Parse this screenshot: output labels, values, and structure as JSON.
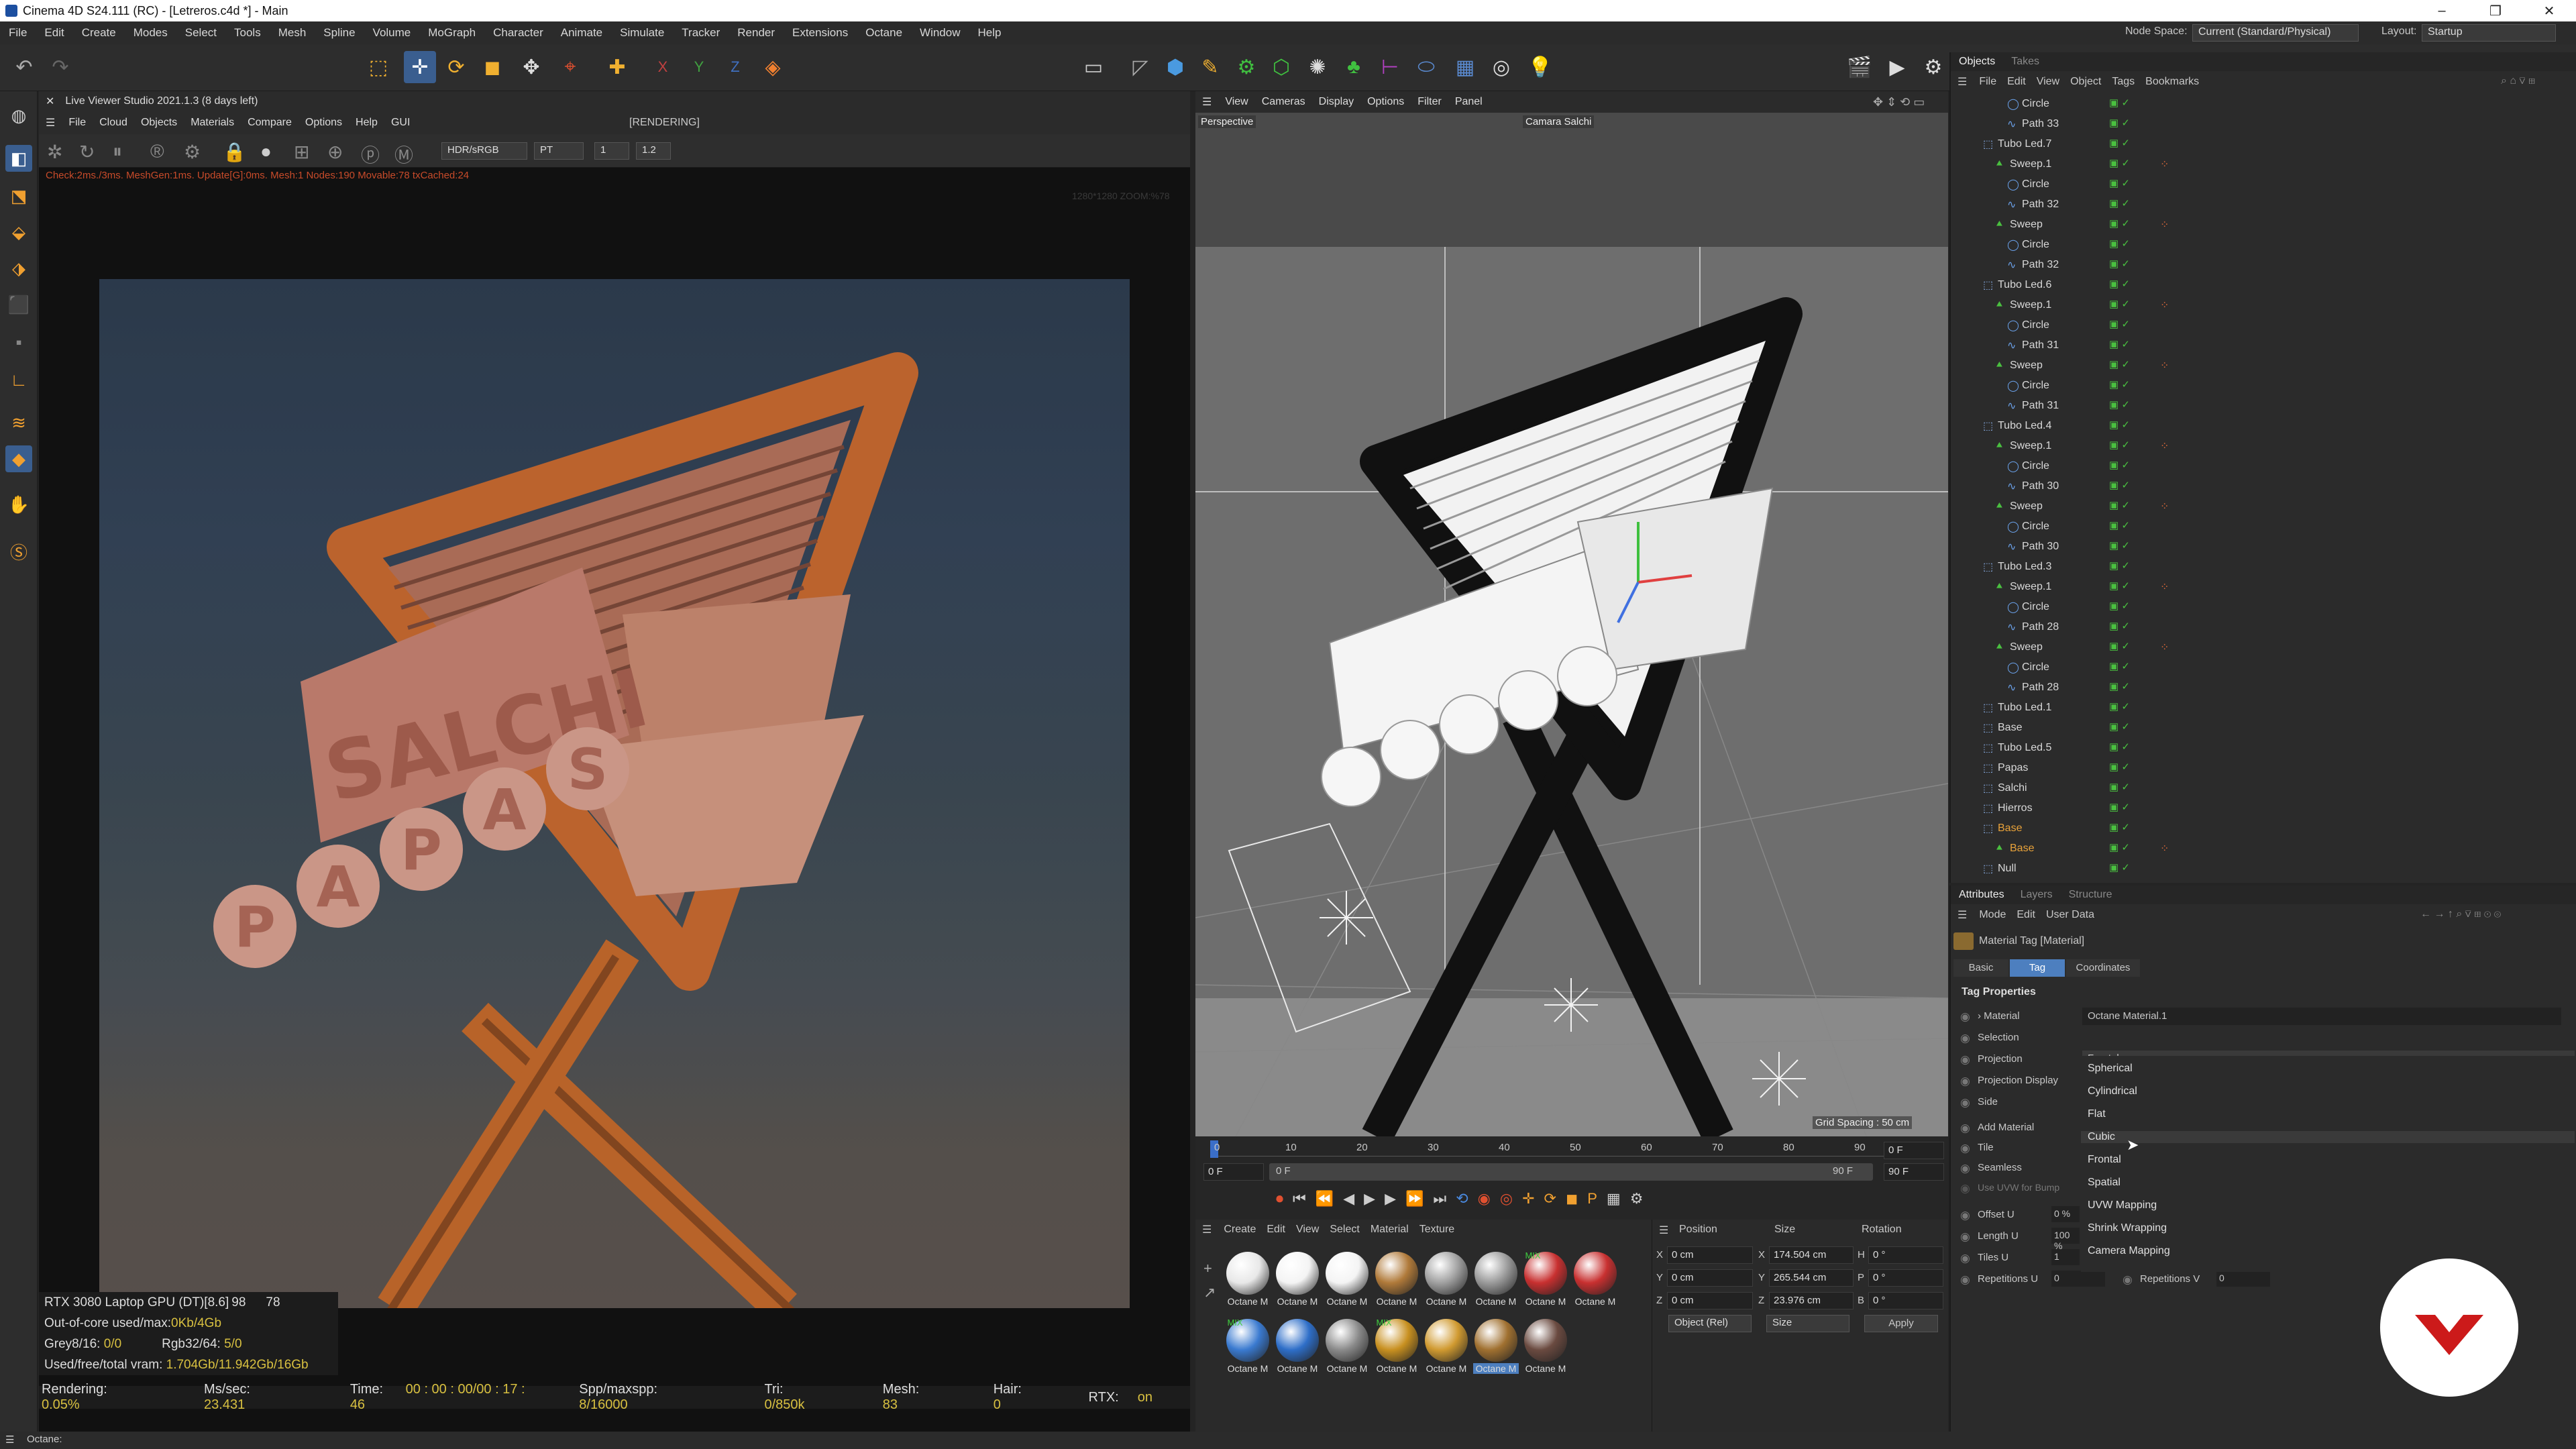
{
  "window": {
    "title": "Cinema 4D S24.111 (RC) - [Letreros.c4d *] - Main"
  },
  "menubar": {
    "items": [
      "File",
      "Edit",
      "Create",
      "Modes",
      "Select",
      "Tools",
      "Mesh",
      "Spline",
      "Volume",
      "MoGraph",
      "Character",
      "Animate",
      "Simulate",
      "Tracker",
      "Render",
      "Extensions",
      "Octane",
      "Window",
      "Help"
    ],
    "node_space_label": "Node Space:",
    "node_space_value": "Current (Standard/Physical)",
    "layout_label": "Layout:",
    "layout_value": "Startup"
  },
  "live_viewer": {
    "title": "Live Viewer Studio 2021.1.3 (8 days left)",
    "menu": [
      "File",
      "Cloud",
      "Objects",
      "Materials",
      "Compare",
      "Options",
      "Help",
      "GUI"
    ],
    "state": "[RENDERING]",
    "color_space": "HDR/sRGB",
    "kernel": "PT",
    "val_a": "1",
    "val_b": "1.2",
    "status_line": "Check:2ms./3ms. MeshGen:1ms. Update[G]:0ms. Mesh:1 Nodes:190 Movable:78 txCached:24",
    "res_text": "1280*1280 ZOOM:%78",
    "gpu": {
      "name": "RTX 3080 Laptop GPU (DT)[8.6]",
      "val1": "98",
      "val2": "78",
      "ooc_label": "Out-of-core used/max:",
      "ooc_value": "0Kb/4Gb",
      "grey_label": "Grey8/16:",
      "grey_value": "0/0",
      "rgb_label": "Rgb32/64:",
      "rgb_value": "5/0",
      "vram_label": "Used/free/total vram:",
      "vram_value": "1.704Gb/11.942Gb/16Gb"
    },
    "stats": {
      "rendering_label": "Rendering:",
      "rendering_value": "0.05%",
      "ms_label": "Ms/sec:",
      "ms_value": "23.431",
      "time_label": "Time:",
      "time_value": "00 : 00 : 00/00 : 17 : 46",
      "spp_label": "Spp/maxspp:",
      "spp_value": "8/16000",
      "tri_label": "Tri:",
      "tri_value": "0/850k",
      "mesh_label": "Mesh:",
      "mesh_value": "83",
      "hair_label": "Hair:",
      "hair_value": "0",
      "rtx_label": "RTX:",
      "rtx_value": "on"
    }
  },
  "viewport": {
    "menu": [
      "View",
      "Cameras",
      "Display",
      "Options",
      "Filter",
      "Panel"
    ],
    "mode_label": "Perspective",
    "camera_label": "Camara Salchi",
    "grid_spacing": "Grid Spacing : 50 cm"
  },
  "timeline": {
    "ticks": [
      "0",
      "10",
      "20",
      "30",
      "40",
      "50",
      "60",
      "70",
      "80",
      "90"
    ],
    "current_frame": "0 F",
    "start": "0 F",
    "start2": "0 F",
    "end": "90 F",
    "end2": "90 F"
  },
  "materials": {
    "menu": [
      "Create",
      "Edit",
      "View",
      "Select",
      "Material",
      "Texture"
    ],
    "items": [
      {
        "label": "Octane M",
        "color": "#e8e8e8"
      },
      {
        "label": "Octane M",
        "color": "#f4f4f4"
      },
      {
        "label": "Octane M",
        "color": "#f4f4f4"
      },
      {
        "label": "Octane M",
        "color": "#b07a3a"
      },
      {
        "label": "Octane M",
        "color": "#a0a0a0"
      },
      {
        "label": "Octane M",
        "color": "#9a9a9a"
      },
      {
        "label": "Octane M",
        "color": "#c83030"
      },
      {
        "label": "Octane M",
        "color": "#c83030"
      },
      {
        "label": "Octane M",
        "color": "#3a7ad0"
      },
      {
        "label": "Octane M",
        "color": "#2e6ec8"
      },
      {
        "label": "Octane M",
        "color": "#8a8a8a"
      },
      {
        "label": "Octane M",
        "color": "#c89020"
      },
      {
        "label": "Octane M",
        "color": "#d09a30"
      },
      {
        "label": "Octane M",
        "color": "#a07030"
      },
      {
        "label": "Octane M",
        "color": "#6a4a40"
      }
    ],
    "mix_badge": "MIX"
  },
  "coordinates": {
    "headers": [
      "Position",
      "Size",
      "Rotation"
    ],
    "rows": [
      {
        "axis": "X",
        "pos": "0 cm",
        "size_axis": "X",
        "size": "174.504 cm",
        "rot_axis": "H",
        "rot": "0 °"
      },
      {
        "axis": "Y",
        "pos": "0 cm",
        "size_axis": "Y",
        "size": "265.544 cm",
        "rot_axis": "P",
        "rot": "0 °"
      },
      {
        "axis": "Z",
        "pos": "0 cm",
        "size_axis": "Z",
        "size": "23.976 cm",
        "rot_axis": "B",
        "rot": "0 °"
      }
    ],
    "mode": "Object (Rel)",
    "size_mode": "Size",
    "apply": "Apply"
  },
  "objects_panel": {
    "tabs": [
      "Objects",
      "Takes"
    ],
    "menu": [
      "File",
      "Edit",
      "View",
      "Object",
      "Tags",
      "Bookmarks"
    ],
    "rows": [
      {
        "label": "Circle",
        "indent": 3,
        "type": "circle"
      },
      {
        "label": "Path 33",
        "indent": 3,
        "type": "path"
      },
      {
        "label": "Tubo Led.7",
        "indent": 1,
        "type": "null"
      },
      {
        "label": "Sweep.1",
        "indent": 2,
        "type": "sweep"
      },
      {
        "label": "Circle",
        "indent": 3,
        "type": "circle"
      },
      {
        "label": "Path 32",
        "indent": 3,
        "type": "path"
      },
      {
        "label": "Sweep",
        "indent": 2,
        "type": "sweep"
      },
      {
        "label": "Circle",
        "indent": 3,
        "type": "circle"
      },
      {
        "label": "Path 32",
        "indent": 3,
        "type": "path"
      },
      {
        "label": "Tubo Led.6",
        "indent": 1,
        "type": "null"
      },
      {
        "label": "Sweep.1",
        "indent": 2,
        "type": "sweep"
      },
      {
        "label": "Circle",
        "indent": 3,
        "type": "circle"
      },
      {
        "label": "Path 31",
        "indent": 3,
        "type": "path"
      },
      {
        "label": "Sweep",
        "indent": 2,
        "type": "sweep"
      },
      {
        "label": "Circle",
        "indent": 3,
        "type": "circle"
      },
      {
        "label": "Path 31",
        "indent": 3,
        "type": "path"
      },
      {
        "label": "Tubo Led.4",
        "indent": 1,
        "type": "null"
      },
      {
        "label": "Sweep.1",
        "indent": 2,
        "type": "sweep"
      },
      {
        "label": "Circle",
        "indent": 3,
        "type": "circle"
      },
      {
        "label": "Path 30",
        "indent": 3,
        "type": "path"
      },
      {
        "label": "Sweep",
        "indent": 2,
        "type": "sweep"
      },
      {
        "label": "Circle",
        "indent": 3,
        "type": "circle"
      },
      {
        "label": "Path 30",
        "indent": 3,
        "type": "path"
      },
      {
        "label": "Tubo Led.3",
        "indent": 1,
        "type": "null"
      },
      {
        "label": "Sweep.1",
        "indent": 2,
        "type": "sweep"
      },
      {
        "label": "Circle",
        "indent": 3,
        "type": "circle"
      },
      {
        "label": "Path 28",
        "indent": 3,
        "type": "path"
      },
      {
        "label": "Sweep",
        "indent": 2,
        "type": "sweep"
      },
      {
        "label": "Circle",
        "indent": 3,
        "type": "circle"
      },
      {
        "label": "Path 28",
        "indent": 3,
        "type": "path"
      },
      {
        "label": "Tubo Led.1",
        "indent": 1,
        "type": "null"
      },
      {
        "label": "Base",
        "indent": 1,
        "type": "null"
      },
      {
        "label": "Tubo Led.5",
        "indent": 1,
        "type": "null"
      },
      {
        "label": "Papas",
        "indent": 1,
        "type": "null"
      },
      {
        "label": "Salchi",
        "indent": 1,
        "type": "null"
      },
      {
        "label": "Hierros",
        "indent": 1,
        "type": "null"
      },
      {
        "label": "Base",
        "indent": 1,
        "type": "null",
        "selected": "orange"
      },
      {
        "label": "Base",
        "indent": 2,
        "type": "sweep",
        "selected": "orange"
      },
      {
        "label": "Null",
        "indent": 1,
        "type": "null"
      }
    ]
  },
  "attributes_panel": {
    "tabs": [
      "Attributes",
      "Layers",
      "Structure"
    ],
    "menu": [
      "Mode",
      "Edit",
      "User Data"
    ],
    "header": "Material Tag [Material]",
    "subtabs": [
      "Basic",
      "Tag",
      "Coordinates"
    ],
    "section": "Tag Properties",
    "fields": {
      "material_label": "Material",
      "material_value": "Octane Material.1",
      "selection_label": "Selection",
      "projection_label": "Projection",
      "projection_value": "Frontal",
      "projection_display_label": "Projection Display",
      "side_label": "Side",
      "add_material_label": "Add Material",
      "tile_label": "Tile",
      "seamless_label": "Seamless",
      "use_uvw_label": "Use UVW for Bump",
      "offset_u_label": "Offset U",
      "offset_u_value": "0 %",
      "length_u_label": "Length U",
      "length_u_value": "100 %",
      "tiles_u_label": "Tiles U",
      "tiles_u_value": "1",
      "repetitions_u_label": "Repetitions U",
      "repetitions_u_value": "0",
      "repetitions_v_label": "Repetitions V",
      "repetitions_v_value": "0"
    },
    "projection_options": [
      "Spherical",
      "Cylindrical",
      "Flat",
      "Cubic",
      "Frontal",
      "Spatial",
      "UVW Mapping",
      "Shrink Wrapping",
      "Camera Mapping"
    ],
    "hovered_option": "Cubic"
  },
  "statusbar": {
    "text": "Octane:"
  },
  "colors": {
    "accent": "#4d7fbf",
    "selected_orange": "#e8a23a",
    "status_red": "#c84b2a",
    "stat_yellow": "#d8c040",
    "logo_red": "#cc1a1a"
  }
}
